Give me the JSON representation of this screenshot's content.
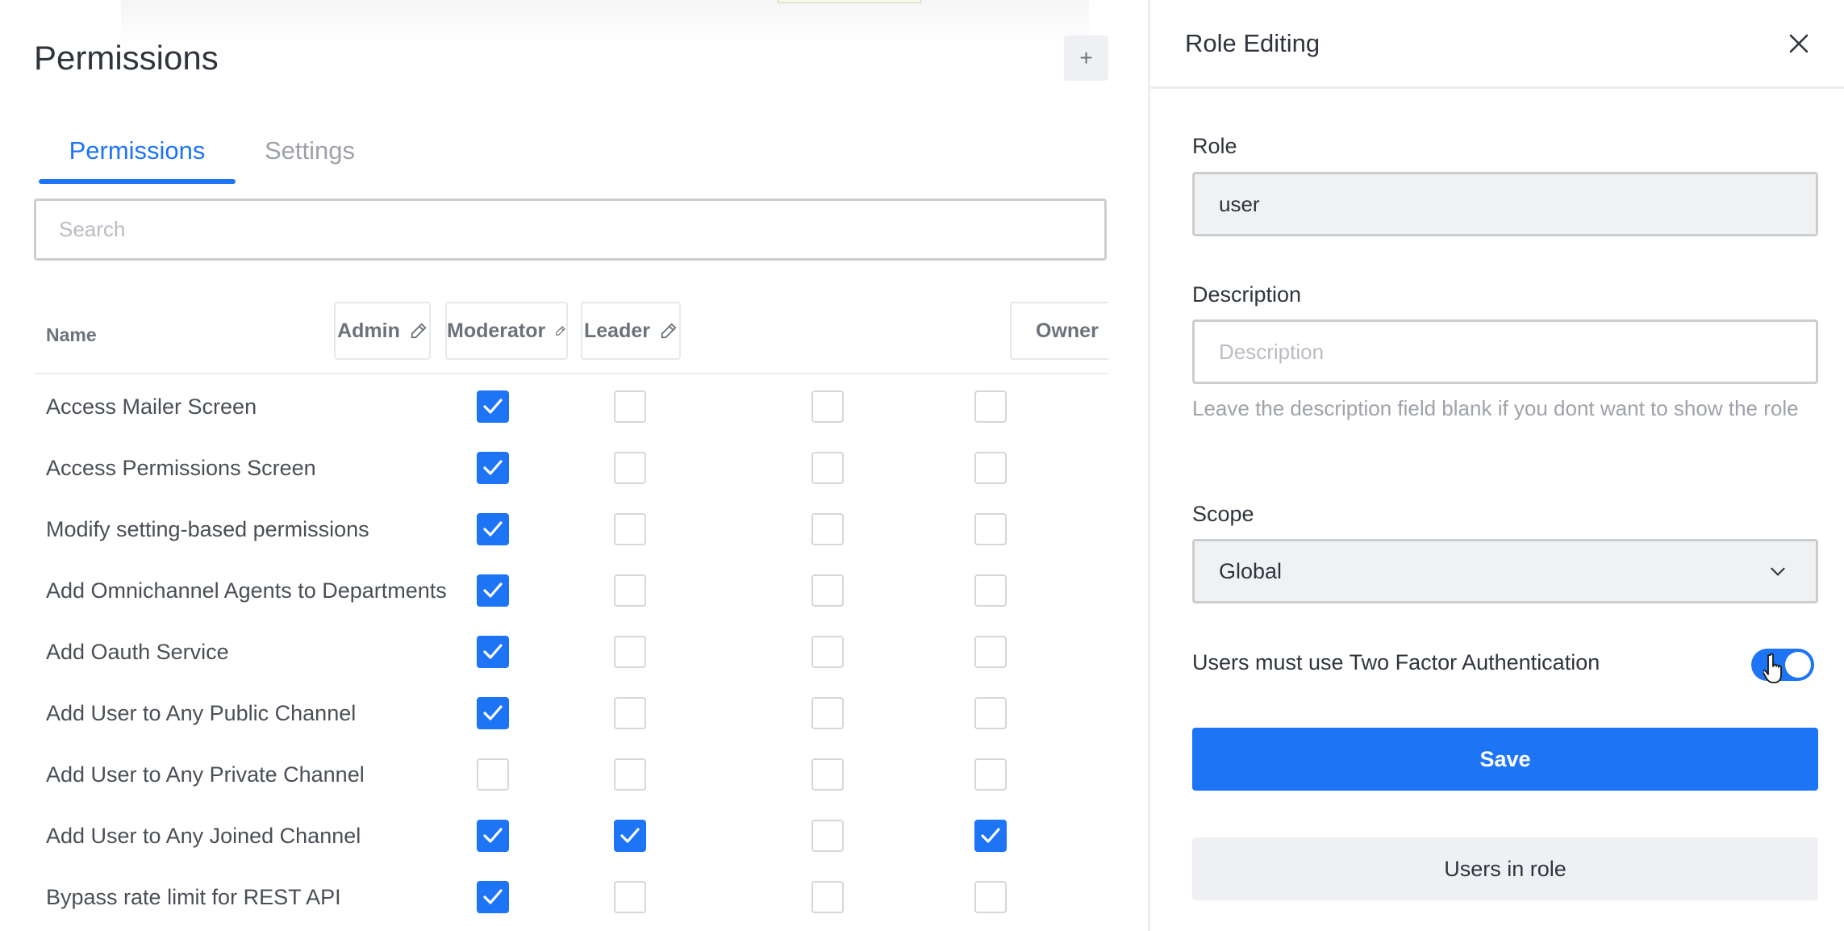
{
  "page": {
    "title": "Permissions",
    "add_button_label": "+"
  },
  "tabs": [
    {
      "label": "Permissions",
      "active": true
    },
    {
      "label": "Settings",
      "active": false
    }
  ],
  "search": {
    "placeholder": "Search",
    "value": ""
  },
  "table": {
    "name_header": "Name",
    "roles": [
      "Admin",
      "Moderator",
      "Leader",
      "Owner"
    ],
    "rows": [
      {
        "name": "Access Mailer Screen",
        "checked": [
          true,
          false,
          false,
          false
        ]
      },
      {
        "name": "Access Permissions Screen",
        "checked": [
          true,
          false,
          false,
          false
        ]
      },
      {
        "name": "Modify setting-based permissions",
        "checked": [
          true,
          false,
          false,
          false
        ]
      },
      {
        "name": "Add Omnichannel Agents to Departments",
        "checked": [
          true,
          false,
          false,
          false
        ]
      },
      {
        "name": "Add Oauth Service",
        "checked": [
          true,
          false,
          false,
          false
        ]
      },
      {
        "name": "Add User to Any Public Channel",
        "checked": [
          true,
          false,
          false,
          false
        ]
      },
      {
        "name": "Add User to Any Private Channel",
        "checked": [
          false,
          false,
          false,
          false
        ]
      },
      {
        "name": "Add User to Any Joined Channel",
        "checked": [
          true,
          true,
          false,
          true
        ]
      },
      {
        "name": "Bypass rate limit for REST API",
        "checked": [
          true,
          false,
          false,
          false
        ]
      }
    ]
  },
  "drawer": {
    "title": "Role Editing",
    "role_label": "Role",
    "role_value": "user",
    "description_label": "Description",
    "description_placeholder": "Description",
    "description_hint": "Leave the description field blank if you dont want to show the role",
    "scope_label": "Scope",
    "scope_value": "Global",
    "two_factor_label": "Users must use Two Factor Authentication",
    "two_factor_enabled": true,
    "save_label": "Save",
    "users_in_role_label": "Users in role"
  },
  "colors": {
    "accent": "#1d74f5",
    "text": "#2f343d",
    "muted": "#9ea2a8"
  },
  "icons": [
    "plus-icon",
    "pencil-icon",
    "checkmark-icon",
    "close-icon",
    "chevron-down-icon",
    "hand-pointer-icon"
  ]
}
